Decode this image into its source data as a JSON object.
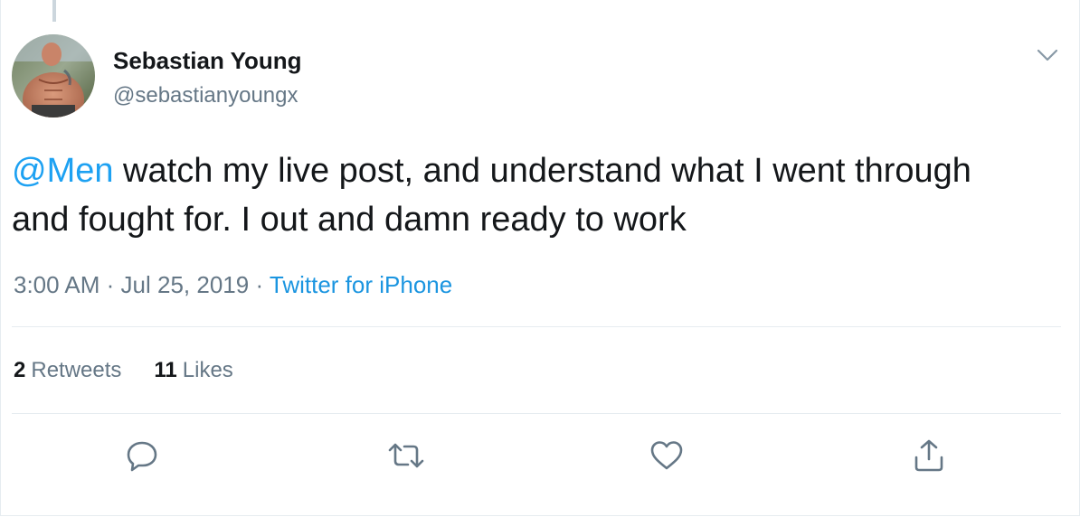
{
  "author": {
    "display_name": "Sebastian Young",
    "handle": "@sebastianyoungx"
  },
  "tweet": {
    "mention": "@Men",
    "text": " watch my live post, and understand what I went through and fought for. I out and damn ready to work"
  },
  "meta": {
    "time": "3:00 AM",
    "separator": "·",
    "date": "Jul 25, 2019",
    "source": "Twitter for iPhone"
  },
  "stats": {
    "retweets_count": "2",
    "retweets_label": "Retweets",
    "likes_count": "11",
    "likes_label": "Likes"
  },
  "icons": {
    "caret": "chevron-down-icon",
    "reply": "reply-icon",
    "retweet": "retweet-icon",
    "like": "heart-icon",
    "share": "share-icon"
  },
  "colors": {
    "link": "#1da1f2",
    "source": "#1b95e0",
    "muted": "#657786",
    "text": "#14171a",
    "divider": "#e6ecf0",
    "thread_line": "#ccd6dd"
  }
}
